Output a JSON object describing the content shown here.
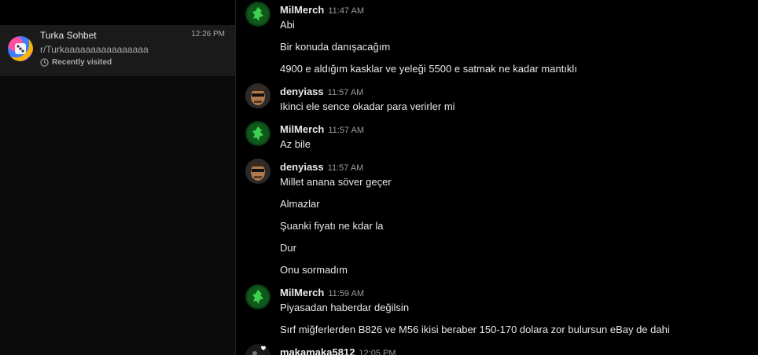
{
  "sidebar": {
    "chat": {
      "name": "Turka Sohbet",
      "time": "12:26 PM",
      "subreddit": "r/Turkaaaaaaaaaaaaaaaa",
      "visited": "Recently visited"
    }
  },
  "messages": [
    {
      "author": "MilMerch",
      "time": "11:47 AM",
      "lines": [
        "Abi",
        "Bir konuda danışacağım",
        "4900 e aldığım kasklar ve yeleği 5500 e satmak ne kadar mantıklı"
      ]
    },
    {
      "author": "denyiass",
      "time": "11:57 AM",
      "lines": [
        "Ikinci ele sence okadar para verirler mi"
      ]
    },
    {
      "author": "MilMerch",
      "time": "11:57 AM",
      "lines": [
        "Az bile"
      ]
    },
    {
      "author": "denyiass",
      "time": "11:57 AM",
      "lines": [
        "Millet anana söver geçer",
        "Almazlar",
        "Şuanki fiyatı ne kdar la",
        "Dur",
        "Onu sormadım"
      ]
    },
    {
      "author": "MilMerch",
      "time": "11:59 AM",
      "lines": [
        "Piyasadan haberdar değilsin",
        "Sırf miğferlerden B826 ve M56 ikisi beraber 150-170 dolara zor bulursun eBay de dahi"
      ]
    },
    {
      "author": "makamaka5812",
      "time": "12:05 PM",
      "lines": []
    }
  ]
}
